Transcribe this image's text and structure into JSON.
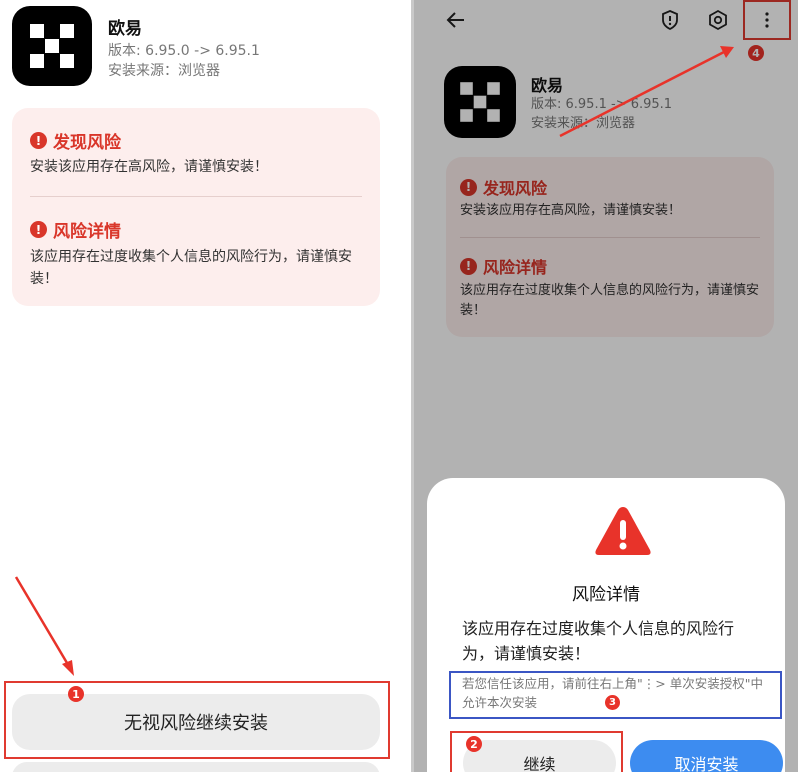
{
  "app": {
    "name": "欧易",
    "version_left": "版本: 6.95.0 -> 6.95.1",
    "version_right": "版本: 6.95.1 -> 6.95.1",
    "source": "安装来源：浏览器"
  },
  "risk": {
    "found_title": "发现风险",
    "found_text": "安装该应用存在高风险，请谨慎安装！",
    "detail_title": "风险详情",
    "detail_text": "该应用存在过度收集个人信息的风险行为，请谨慎安装！"
  },
  "left_panel": {
    "ignore_button": "无视风险继续安装"
  },
  "dialog": {
    "title": "风险详情",
    "body": "该应用存在过度收集个人信息的风险行为，请谨慎安装！",
    "hint": "若您信任该应用，请前往右上角\"⋮> 单次安装授权\"中允许本次安装",
    "continue_button": "继续",
    "cancel_button": "取消安装"
  },
  "step_badges": [
    "1",
    "2",
    "3",
    "4"
  ],
  "icons": {
    "back": "arrow-left-icon",
    "shield": "shield-alert-icon",
    "settings": "gear-hexagon-icon",
    "more": "more-vertical-icon",
    "info": "info-icon",
    "warning": "warning-triangle-icon"
  },
  "colors": {
    "danger": "#d9362a",
    "primary": "#3d8cf0",
    "annotation_red": "#e03a30",
    "annotation_blue": "#3b56c4"
  }
}
